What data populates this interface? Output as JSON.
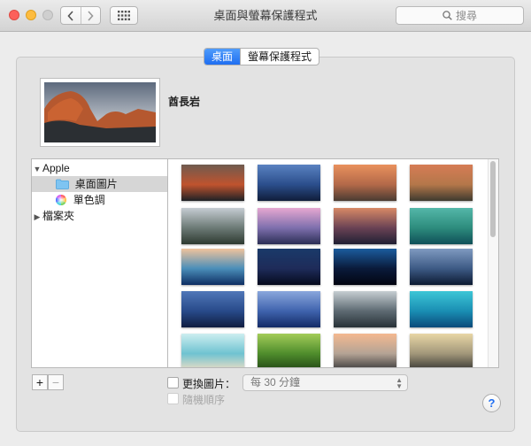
{
  "window": {
    "title": "桌面與螢幕保護程式"
  },
  "search": {
    "placeholder": "搜尋"
  },
  "tabs": [
    {
      "label": "桌面",
      "active": true
    },
    {
      "label": "螢幕保護程式",
      "active": false
    }
  ],
  "current_wallpaper": {
    "name": "酋長岩"
  },
  "sources": {
    "apple": {
      "label": "Apple",
      "expanded": true
    },
    "desktop_pictures": {
      "label": "桌面圖片",
      "selected": true
    },
    "solid_colors": {
      "label": "單色調"
    },
    "folders": {
      "label": "檔案夾",
      "expanded": false
    }
  },
  "thumbnails": [
    {
      "colors": [
        "#6f5b4f",
        "#c0532e",
        "#1e2126"
      ]
    },
    {
      "colors": [
        "#5a82c1",
        "#2b4e8c",
        "#101d3a"
      ]
    },
    {
      "colors": [
        "#e9915d",
        "#b36949",
        "#4a3b32"
      ]
    },
    {
      "colors": [
        "#d67c55",
        "#b4774a",
        "#3e3a2f"
      ]
    },
    {
      "colors": [
        "#c5ccd2",
        "#6c7a76",
        "#2e3a31"
      ]
    },
    {
      "colors": [
        "#e6a7d1",
        "#7e6fad",
        "#2b2e55"
      ]
    },
    {
      "colors": [
        "#d88966",
        "#6a4254",
        "#202034"
      ]
    },
    {
      "colors": [
        "#54b7a9",
        "#2d8c7d",
        "#0f4f58"
      ]
    },
    {
      "colors": [
        "#f0c39c",
        "#4a8eb9",
        "#0e2e63"
      ]
    },
    {
      "colors": [
        "#1a3a6a",
        "#1e2b59",
        "#050a1d"
      ]
    },
    {
      "colors": [
        "#1b5c9e",
        "#0a1a3a",
        "#020511"
      ]
    },
    {
      "colors": [
        "#7f9ac0",
        "#3d5a85",
        "#0c1a32"
      ]
    },
    {
      "colors": [
        "#5077b8",
        "#284a8a",
        "#0f1d40"
      ]
    },
    {
      "colors": [
        "#8aa6dc",
        "#3f63ad",
        "#132a66"
      ]
    },
    {
      "colors": [
        "#c6ced2",
        "#5d6a72",
        "#283137"
      ]
    },
    {
      "colors": [
        "#3dc6d6",
        "#1a8eb3",
        "#0a4a7a"
      ]
    },
    {
      "colors": [
        "#cdeef0",
        "#6fc3d1",
        "#e8dcc5"
      ]
    },
    {
      "colors": [
        "#a3cc58",
        "#4f8d2c",
        "#244a16"
      ]
    },
    {
      "colors": [
        "#f4b990",
        "#b4a395",
        "#3d3d3e"
      ]
    },
    {
      "colors": [
        "#e8d6a5",
        "#a2977a",
        "#3b3a35"
      ]
    }
  ],
  "controls": {
    "add": "+",
    "remove": "−",
    "change_picture": {
      "label": "更換圖片：",
      "checked": false
    },
    "interval": {
      "value": "每 30 分鐘"
    },
    "random_order": {
      "label": "隨機順序",
      "checked": false
    },
    "help": "?"
  }
}
